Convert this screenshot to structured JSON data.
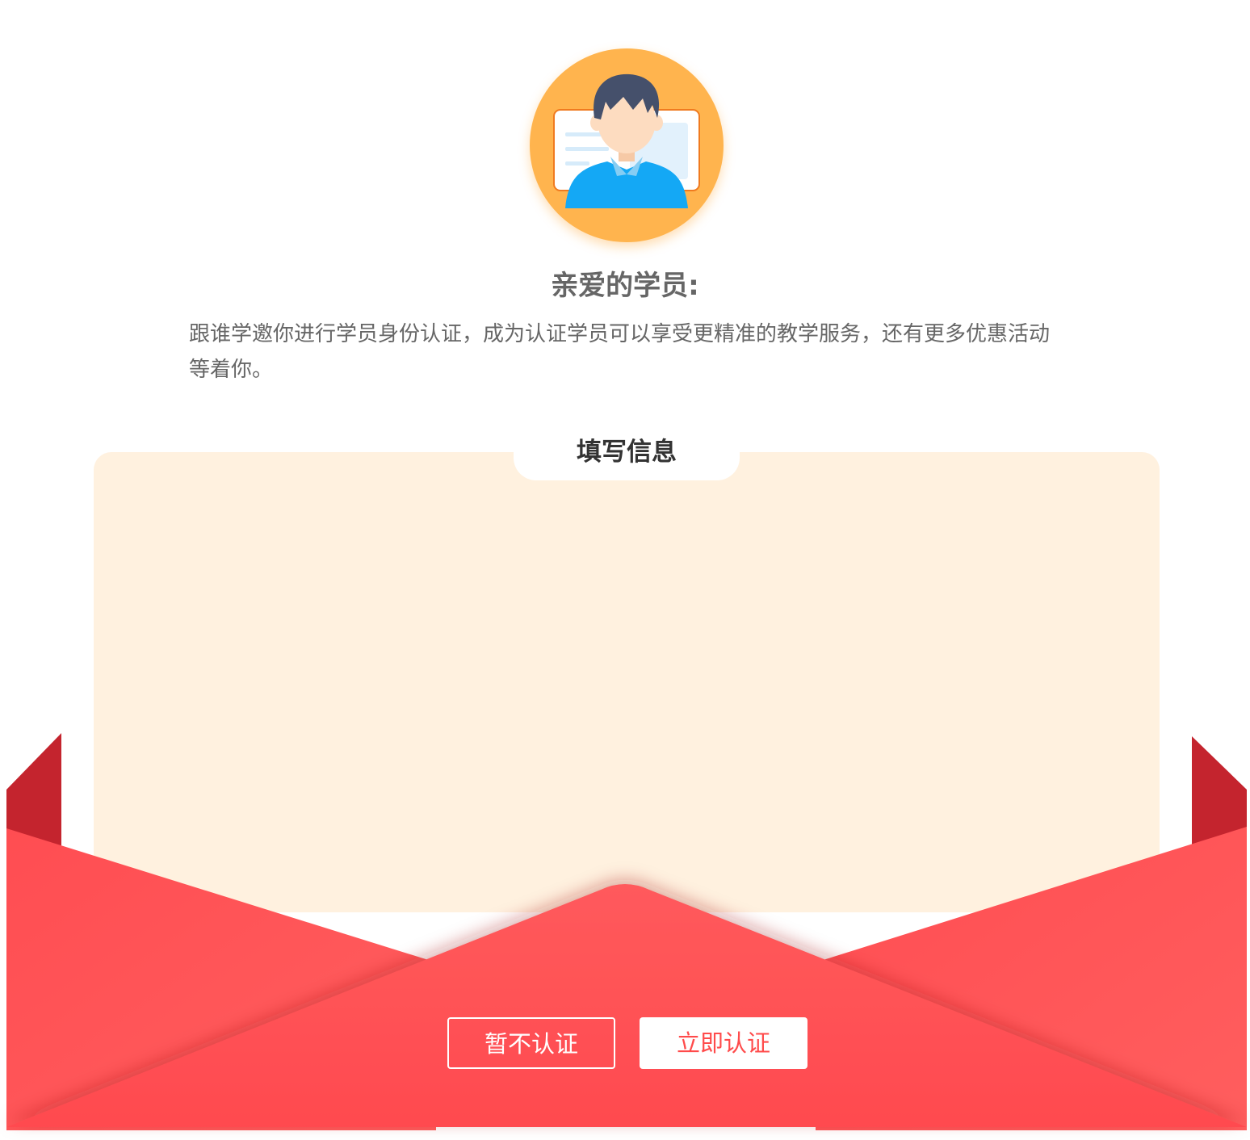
{
  "greeting": {
    "title": "亲爱的学员:",
    "body": "跟谁学邀你进行学员身份认证，成为认证学员可以享受更精准的教学服务，还有更多优惠活动等着你。"
  },
  "form": {
    "tab_title": "填写信息"
  },
  "actions": {
    "skip_label": "暂不认证",
    "verify_label": "立即认证"
  },
  "colors": {
    "avatar_bg": "#ffb44e",
    "card_bg": "#fff1df",
    "envelope_red": "#ff4b4f",
    "envelope_dark": "#c4242e",
    "shirt_blue": "#14a8f5"
  },
  "icons": {
    "avatar": "student-id-avatar-icon"
  }
}
